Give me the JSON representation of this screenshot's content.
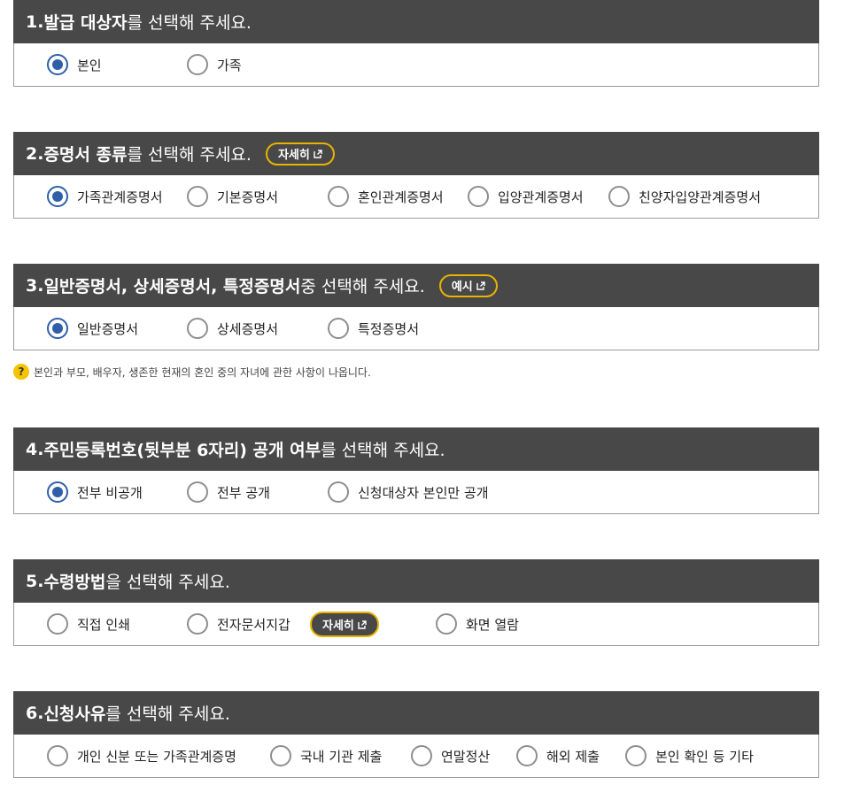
{
  "s1": {
    "num": "1. ",
    "bold": "발급 대상자",
    "rest": "를 선택해 주세요.",
    "options": [
      "본인",
      "가족"
    ],
    "selected": "본인"
  },
  "s2": {
    "num": "2. ",
    "bold": "증명서 종류",
    "rest": "를 선택해 주세요.",
    "button": "자세히",
    "options": [
      "가족관계증명서",
      "기본증명서",
      "혼인관계증명서",
      "입양관계증명서",
      "친양자입양관계증명서"
    ],
    "selected": "가족관계증명서"
  },
  "s3": {
    "num": "3. ",
    "bold": "일반증명서, 상세증명서, 특정증명서",
    "rest": " 중 선택해 주세요.",
    "button": "예시",
    "options": [
      "일반증명서",
      "상세증명서",
      "특정증명서"
    ],
    "selected": "일반증명서",
    "note_icon": "?",
    "note": "본인과 부모, 배우자, 생존한 현재의 혼인 중의 자녀에 관한 사항이 나옵니다."
  },
  "s4": {
    "num": "4. ",
    "bold": "주민등록번호(뒷부분 6자리) 공개 여부",
    "rest": "를 선택해 주세요.",
    "options": [
      "전부 비공개",
      "전부 공개",
      "신청대상자 본인만 공개"
    ],
    "selected": "전부 비공개"
  },
  "s5": {
    "num": "5. ",
    "bold": "수령방법",
    "rest": "을 선택해 주세요.",
    "button": "자세히",
    "options": [
      "직접 인쇄",
      "전자문서지갑",
      "화면 열람"
    ],
    "selected": ""
  },
  "s6": {
    "num": "6. ",
    "bold": "신청사유",
    "rest": "를 선택해 주세요.",
    "options": [
      "개인 신분 또는 가족관계증명",
      "국내 기관 제출",
      "연말정산",
      "해외 제출",
      "본인 확인 등 기타"
    ],
    "selected": ""
  },
  "colors": {
    "header_bg": "#484848",
    "radio_selected": "#2f5fa8",
    "button_border": "#e8b400",
    "help_icon": "#f5c400"
  },
  "icons": {
    "external": "external-link-icon",
    "help": "question-icon"
  }
}
